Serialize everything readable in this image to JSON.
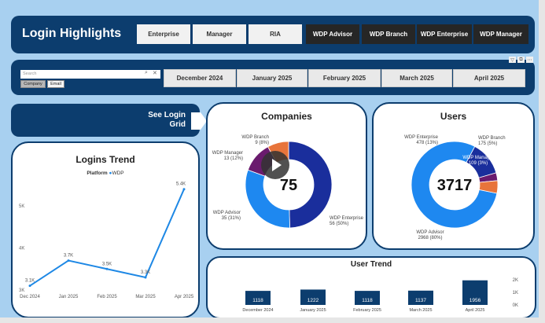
{
  "header": {
    "title": "Login Highlights",
    "buttons": [
      {
        "label": "Enterprise",
        "style": "light"
      },
      {
        "label": "Manager",
        "style": "light"
      },
      {
        "label": "RIA",
        "style": "light"
      },
      {
        "label": "WDP Advisor",
        "style": "dark"
      },
      {
        "label": "WDP Branch",
        "style": "dark"
      },
      {
        "label": "WDP Enterprise",
        "style": "dark"
      },
      {
        "label": "WDP Manager",
        "style": "dark"
      }
    ]
  },
  "filter": {
    "search_placeholder": "Search",
    "tabs": [
      {
        "label": "Company"
      },
      {
        "label": "Email"
      }
    ],
    "months": [
      "December 2024",
      "January 2025",
      "February 2025",
      "March 2025",
      "April 2025"
    ],
    "mini_icons": [
      "filter-icon",
      "focus-icon",
      "more-icon"
    ]
  },
  "see_login": {
    "label": "See Login\nGrid"
  },
  "logins_trend": {
    "title": "Logins Trend",
    "legend_title": "Platform",
    "legend_item": "WDP",
    "color": "#1e88e5",
    "chart_data": {
      "type": "line",
      "categories": [
        "Dec 2024",
        "Jan 2025",
        "Feb 2025",
        "Mar 2025",
        "Apr 2025"
      ],
      "values": [
        3100,
        3700,
        3500,
        3300,
        5400
      ],
      "point_labels": [
        "3.1K",
        "3.7K",
        "3.5K",
        "3.3K",
        "5.4K"
      ],
      "y_ticks": [
        "5K",
        "4K",
        "3K"
      ],
      "y_tick_values": [
        5000,
        4000,
        3000
      ],
      "ylim": [
        3000,
        5600
      ]
    }
  },
  "companies": {
    "title": "Companies",
    "center_value": "75",
    "chart_data": {
      "type": "pie",
      "donut": true,
      "slices": [
        {
          "name": "WDP Enterprise",
          "value": 56,
          "label": "WDP Enterprise\n56 (50%)",
          "color": "#1a2e9c"
        },
        {
          "name": "WDP Advisor",
          "value": 35,
          "label": "WDP Advisor\n35 (31%)",
          "color": "#1e88f0"
        },
        {
          "name": "WDP Manager",
          "value": 13,
          "label": "WDP Manager\n13 (12%)",
          "color": "#6a1b6e"
        },
        {
          "name": "WDP Branch",
          "value": 9,
          "label": "WDP Branch\n9 (8%)",
          "color": "#e8743b"
        }
      ]
    }
  },
  "users": {
    "title": "Users",
    "center_value": "3717",
    "chart_data": {
      "type": "pie",
      "donut": true,
      "slices": [
        {
          "name": "WDP Advisor",
          "value": 2968,
          "label": "WDP Advisor\n2968 (80%)",
          "color": "#1e88f0"
        },
        {
          "name": "WDP Enterprise",
          "value": 478,
          "label": "WDP Enterprise\n478 (13%)",
          "color": "#1a2e9c"
        },
        {
          "name": "WDP Manager",
          "value": 109,
          "label": "WDP Manager\n109 (3%)",
          "color": "#6a1b6e"
        },
        {
          "name": "WDP Branch",
          "value": 175,
          "label": "WDP Branch\n175 (5%)",
          "color": "#e8743b"
        }
      ]
    }
  },
  "user_trend": {
    "title": "User Trend",
    "color": "#0c3d6e",
    "chart_data": {
      "type": "bar",
      "categories": [
        "December 2024",
        "January 2025",
        "February 2025",
        "March 2025",
        "April 2025"
      ],
      "values": [
        1118,
        1222,
        1118,
        1137,
        1956
      ],
      "value_labels": [
        "1118",
        "1222",
        "1118",
        "1137",
        "1956"
      ],
      "y_ticks": [
        "2K",
        "1K",
        "0K"
      ],
      "y_tick_values": [
        2000,
        1000,
        0
      ],
      "ylim": [
        0,
        2000
      ]
    }
  }
}
